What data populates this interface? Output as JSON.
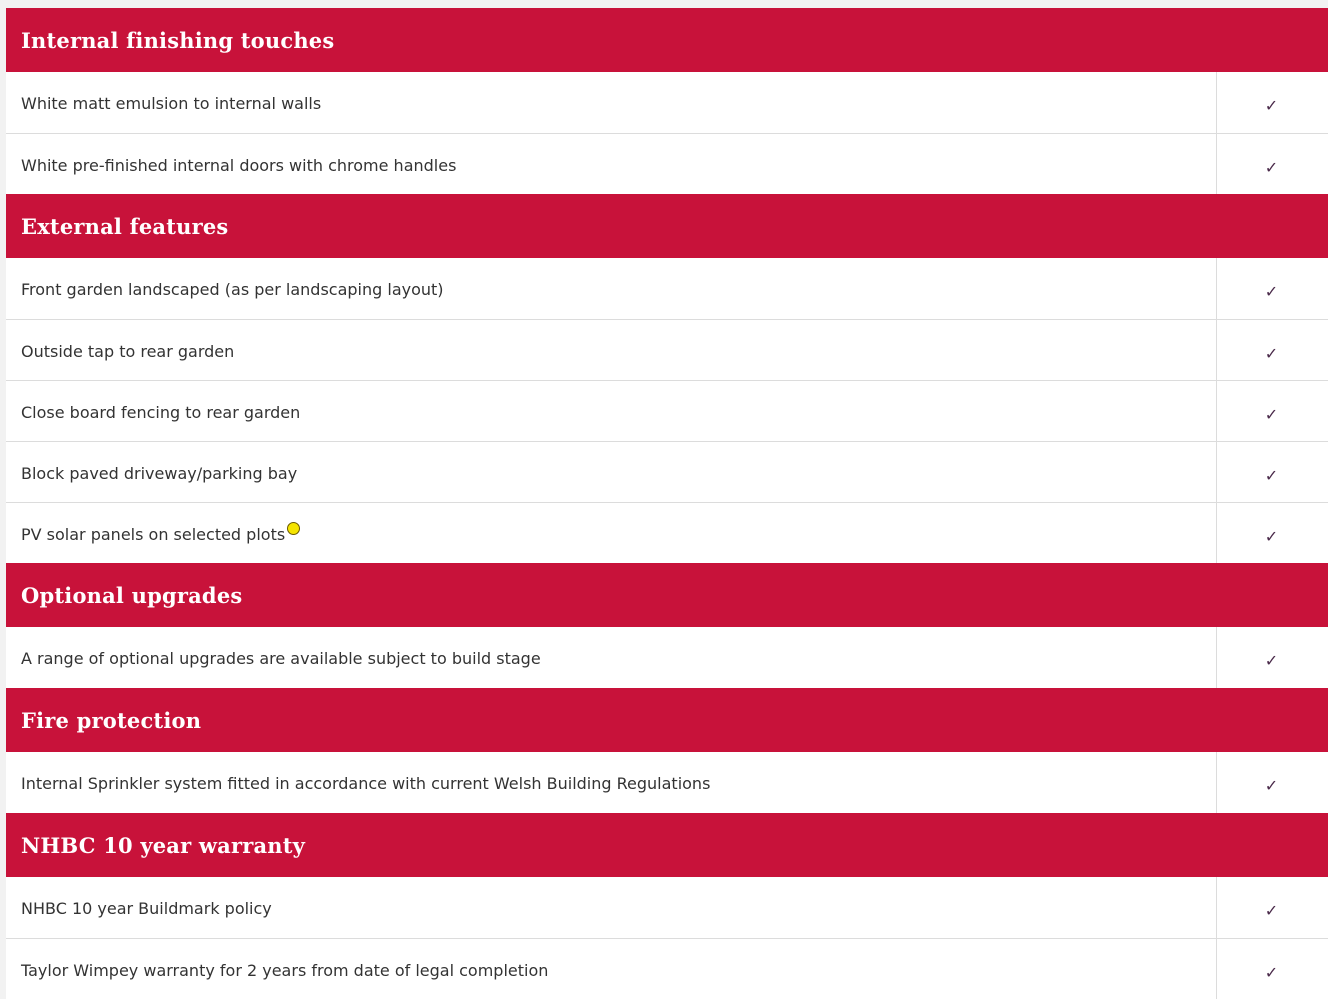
{
  "sections": [
    {
      "title": "Internal finishing touches",
      "items": [
        {
          "label": "White matt emulsion to internal walls",
          "check": "✓"
        },
        {
          "label": "White pre-finished internal doors with chrome handles",
          "check": "✓"
        }
      ]
    },
    {
      "title": "External features",
      "items": [
        {
          "label": "Front garden landscaped (as per landscaping layout)",
          "check": "✓"
        },
        {
          "label": "Outside tap to rear garden",
          "check": "✓"
        },
        {
          "label": "Close board fencing to rear garden",
          "check": "✓"
        },
        {
          "label": "Block paved driveway/parking bay",
          "check": "✓"
        },
        {
          "label": "PV solar panels on selected plots",
          "check": "✓",
          "has_marker": true
        }
      ]
    },
    {
      "title": "Optional upgrades",
      "items": [
        {
          "label": "A range of optional upgrades are available subject to build stage",
          "check": "✓"
        }
      ]
    },
    {
      "title": "Fire protection",
      "items": [
        {
          "label": "Internal Sprinkler system fitted in accordance with current Welsh Building Regulations",
          "check": "✓"
        }
      ]
    },
    {
      "title": "NHBC 10 year warranty",
      "items": [
        {
          "label": "NHBC 10 year Buildmark policy",
          "check": "✓"
        },
        {
          "label": "Taylor Wimpey warranty for 2 years from date of legal completion",
          "check": "✓"
        }
      ]
    }
  ],
  "colors": {
    "header_bg": "#c8123a",
    "header_text": "#ffffff",
    "marker": "#f5e400"
  }
}
